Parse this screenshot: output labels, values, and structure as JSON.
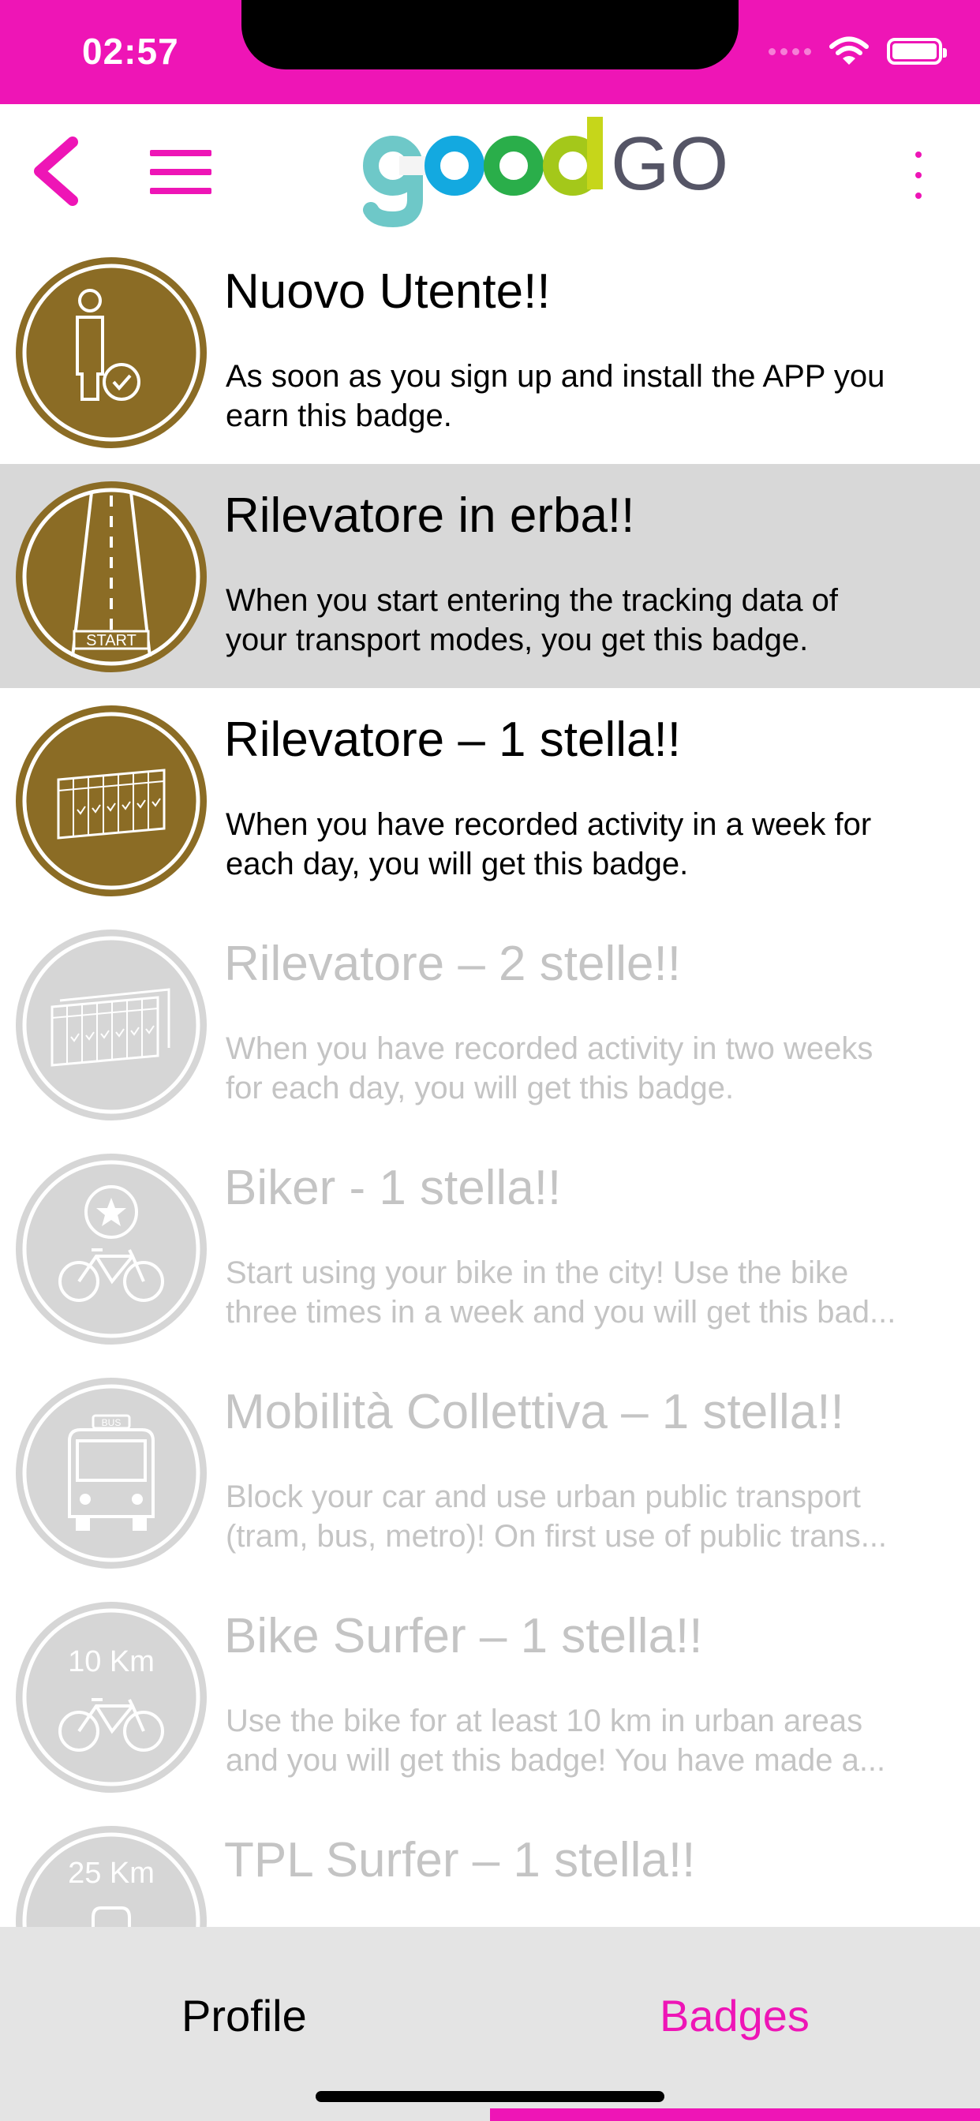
{
  "status_bar": {
    "time": "02:57"
  },
  "header": {
    "logo_text": "goodGO",
    "colors": {
      "accent": "#ee15b6"
    }
  },
  "badges": [
    {
      "title": "Nuovo Utente!!",
      "desc": [
        "As soon as you sign up and install the APP you",
        "earn this badge."
      ],
      "icon": "user-check-icon",
      "state": "earned"
    },
    {
      "title": "Rilevatore in erba!!",
      "desc": [
        "When you start entering the tracking data of",
        "your transport modes, you get this badge."
      ],
      "icon": "road-start-icon",
      "state": "earned",
      "selected": true,
      "icon_label": "START"
    },
    {
      "title": "Rilevatore – 1 stella!!",
      "desc": [
        "When you have recorded activity in a week for",
        "each day, you will get this badge."
      ],
      "icon": "calendar-week-icon",
      "state": "earned"
    },
    {
      "title": "Rilevatore – 2 stelle!!",
      "desc": [
        "When you have recorded activity in two weeks",
        "for each day, you will get this badge."
      ],
      "icon": "calendar-two-weeks-icon",
      "state": "locked"
    },
    {
      "title": "Biker - 1 stella!!",
      "desc": [
        "Start using your bike in the city! Use the bike",
        "three times in a week and you will get this bad..."
      ],
      "icon": "bike-star-icon",
      "state": "locked"
    },
    {
      "title": "Mobilità Collettiva – 1 stella!!",
      "desc": [
        "Block your car and use urban public transport",
        "(tram, bus, metro)! On first use of public trans..."
      ],
      "icon": "bus-icon",
      "state": "locked",
      "icon_label": "BUS"
    },
    {
      "title": "Bike Surfer – 1 stella!!",
      "desc": [
        "Use the bike for at least 10 km in urban areas",
        "and you will get this badge! You have made a..."
      ],
      "icon": "bike-10km-icon",
      "state": "locked",
      "icon_label": "10 Km"
    },
    {
      "title": "TPL Surfer – 1 stella!!",
      "desc": [
        "",
        ""
      ],
      "icon": "bus-25km-icon",
      "state": "locked",
      "icon_label": "25 Km"
    }
  ],
  "tabs": [
    {
      "label": "Profile",
      "active": false
    },
    {
      "label": "Badges",
      "active": true
    }
  ]
}
